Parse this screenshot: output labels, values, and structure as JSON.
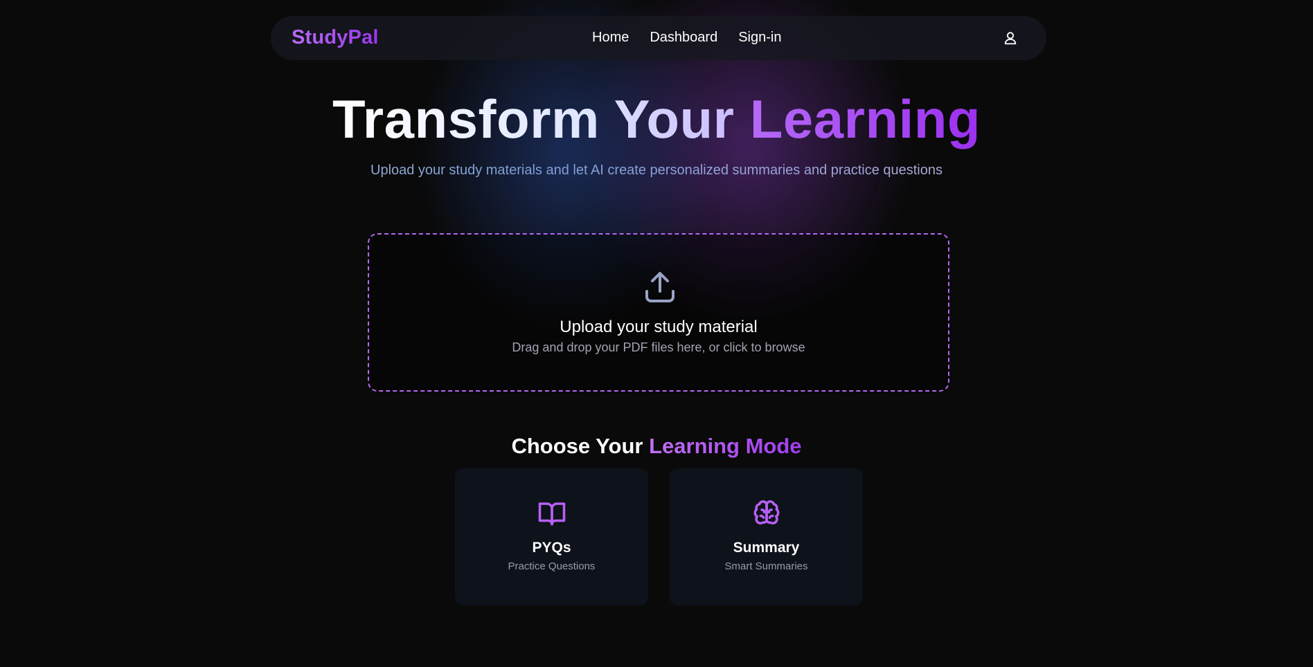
{
  "nav": {
    "logo": "StudyPal",
    "links": [
      {
        "label": "Home"
      },
      {
        "label": "Dashboard"
      },
      {
        "label": "Sign-in"
      }
    ],
    "user_icon": "user-icon"
  },
  "hero": {
    "title_part1": "Transform Your ",
    "title_part2": "Learning",
    "subtitle": "Upload your study materials and let AI create personalized summaries and practice questions"
  },
  "upload": {
    "icon": "upload-icon",
    "title": "Upload your study material",
    "subtitle": "Drag and drop your PDF files here, or click to browse"
  },
  "modes": {
    "title_part1": "Choose Your ",
    "title_part2": "Learning Mode",
    "cards": [
      {
        "icon": "book-open-icon",
        "title": "PYQs",
        "subtitle": "Practice Questions"
      },
      {
        "icon": "brain-icon",
        "title": "Summary",
        "subtitle": "Smart Summaries"
      }
    ]
  },
  "colors": {
    "background": "#0a0a0a",
    "accent": "#a855f7",
    "card": "#0e121a",
    "muted_text": "#a3a3b3"
  }
}
